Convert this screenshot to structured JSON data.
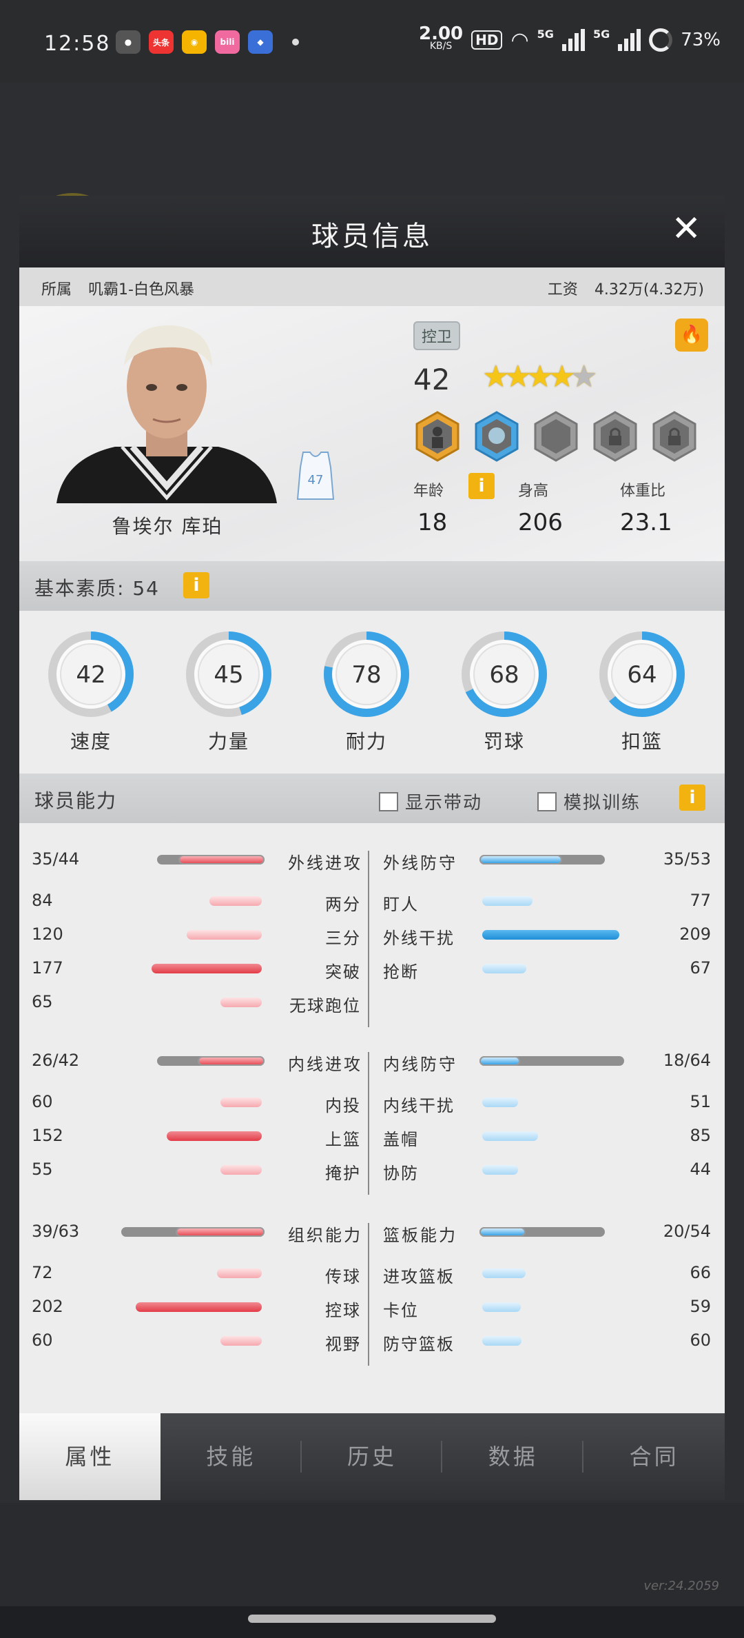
{
  "status_bar": {
    "time": "12:58",
    "speed_value": "2.00",
    "speed_unit": "KB/S",
    "hd": "HD",
    "network": "5G",
    "battery": "73%"
  },
  "dialog": {
    "title": "球员信息",
    "close_icon": "close-icon",
    "team_label": "所属",
    "team_name": "叽霸1-白色风暴",
    "salary_label": "工资",
    "salary_value": "4.32万(4.32万)"
  },
  "player": {
    "name": "鲁埃尔 库珀",
    "jersey_number": "47",
    "position": "控卫",
    "rating": "42",
    "stars": 4.5,
    "age_label": "年龄",
    "age": "18",
    "height_label": "身高",
    "height": "206",
    "weight_label": "体重比",
    "weight_ratio": "23.1"
  },
  "basic": {
    "title": "基本素质: 54",
    "attributes": [
      {
        "label": "速度",
        "value": "42"
      },
      {
        "label": "力量",
        "value": "45"
      },
      {
        "label": "耐力",
        "value": "78"
      },
      {
        "label": "罚球",
        "value": "68"
      },
      {
        "label": "扣篮",
        "value": "64"
      }
    ]
  },
  "ability": {
    "title": "球员能力",
    "show_drive": "显示带动",
    "sim_training": "模拟训练",
    "groups": [
      {
        "left": {
          "name": "外线进攻",
          "score": "35/44",
          "ratio": 0.8
        },
        "right": {
          "name": "外线防守",
          "score": "35/53",
          "ratio": 0.66
        },
        "left_items": [
          {
            "label": "两分",
            "value": "84"
          },
          {
            "label": "三分",
            "value": "120"
          },
          {
            "label": "突破",
            "value": "177"
          },
          {
            "label": "无球跑位",
            "value": "65"
          }
        ],
        "right_items": [
          {
            "label": "盯人",
            "value": "77"
          },
          {
            "label": "外线干扰",
            "value": "209"
          },
          {
            "label": "抢断",
            "value": "67"
          }
        ]
      },
      {
        "left": {
          "name": "内线进攻",
          "score": "26/42",
          "ratio": 0.62
        },
        "right": {
          "name": "内线防守",
          "score": "18/64",
          "ratio": 0.28
        },
        "left_items": [
          {
            "label": "内投",
            "value": "60"
          },
          {
            "label": "上篮",
            "value": "152"
          },
          {
            "label": "掩护",
            "value": "55"
          }
        ],
        "right_items": [
          {
            "label": "内线干扰",
            "value": "51"
          },
          {
            "label": "盖帽",
            "value": "85"
          },
          {
            "label": "协防",
            "value": "44"
          }
        ]
      },
      {
        "left": {
          "name": "组织能力",
          "score": "39/63",
          "ratio": 0.62
        },
        "right": {
          "name": "篮板能力",
          "score": "20/54",
          "ratio": 0.37
        },
        "left_items": [
          {
            "label": "传球",
            "value": "72"
          },
          {
            "label": "控球",
            "value": "202"
          },
          {
            "label": "视野",
            "value": "60"
          }
        ],
        "right_items": [
          {
            "label": "进攻篮板",
            "value": "66"
          },
          {
            "label": "卡位",
            "value": "59"
          },
          {
            "label": "防守篮板",
            "value": "60"
          }
        ]
      }
    ]
  },
  "tabs": [
    "属性",
    "技能",
    "历史",
    "数据",
    "合同"
  ],
  "active_tab": 0,
  "version": "ver:24.2059",
  "colors": {
    "attack_fill": "#e8505b",
    "defense_fill": "#2f9fe3",
    "gold": "#f2b20f"
  }
}
